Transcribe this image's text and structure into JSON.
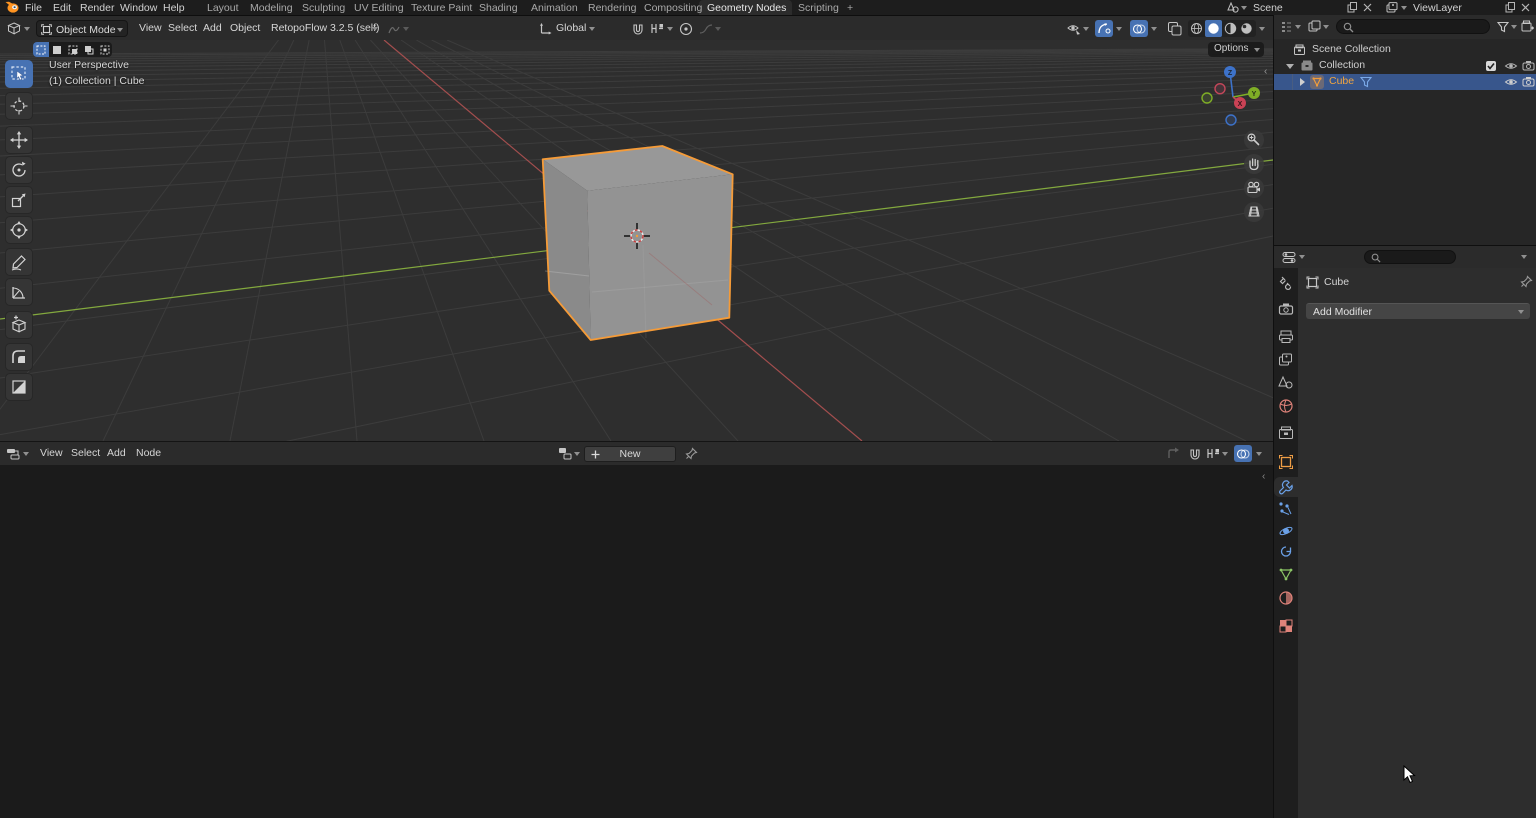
{
  "topbar": {
    "menus": [
      "File",
      "Edit",
      "Render",
      "Window",
      "Help"
    ],
    "tabs": [
      "Layout",
      "Modeling",
      "Sculpting",
      "UV Editing",
      "Texture Paint",
      "Shading",
      "Animation",
      "Rendering",
      "Compositing",
      "Geometry Nodes",
      "Scripting"
    ],
    "add_tab": "+",
    "scene": "Scene",
    "view_layer": "ViewLayer"
  },
  "viewport_header": {
    "mode": "Object Mode",
    "menus": [
      "View",
      "Select",
      "Add",
      "Object"
    ],
    "addon": "RetopoFlow 3.2.5 (self)",
    "orientation": "Global"
  },
  "tool_settings": {
    "options": "Options"
  },
  "viewport": {
    "perspective_label": "User Perspective",
    "context_label": "(1) Collection | Cube",
    "axis_x": "X",
    "axis_y": "Y",
    "axis_z": "Z"
  },
  "node_editor": {
    "menus": [
      "View",
      "Select",
      "Add",
      "Node"
    ],
    "new_button": "New"
  },
  "outliner": {
    "scene_collection": "Scene Collection",
    "collection": "Collection",
    "cube": "Cube"
  },
  "properties": {
    "breadcrumb": "Cube",
    "add_modifier": "Add Modifier"
  },
  "colors": {
    "selection_blue": "#4772b3",
    "object_orange": "#f09c3c",
    "axis_x": "#a34e4e",
    "axis_y": "#83a93e",
    "axis_z": "#3d72c9"
  }
}
